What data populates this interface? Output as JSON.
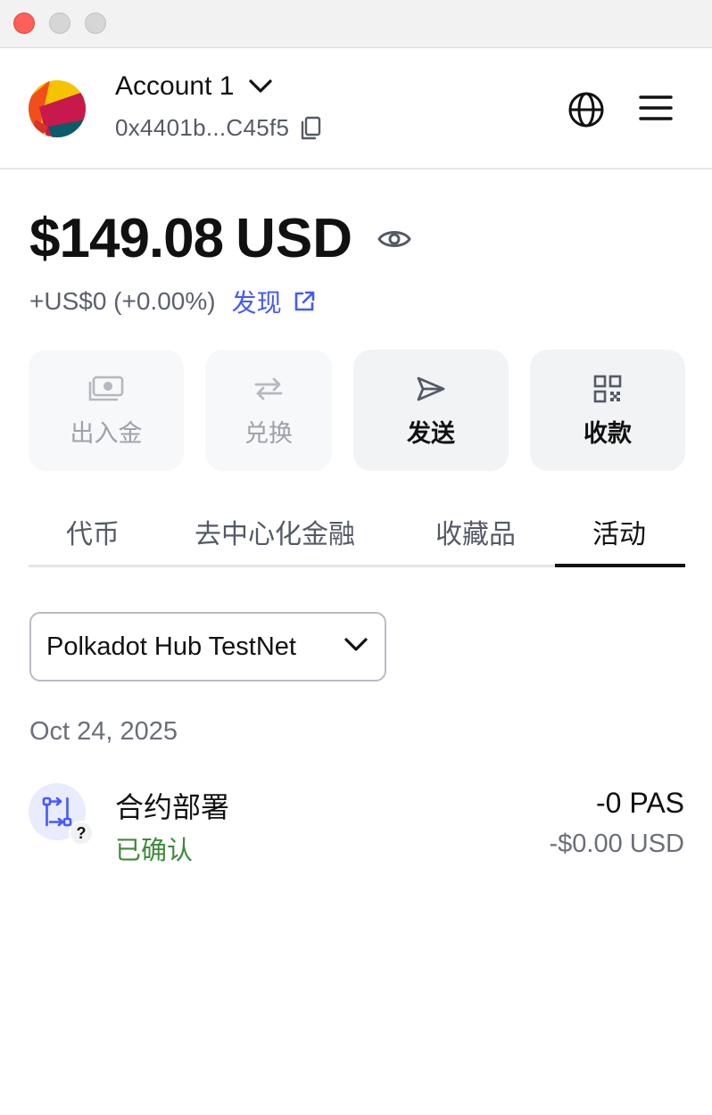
{
  "header": {
    "account_name": "Account 1",
    "account_address": "0x4401b...C45f5"
  },
  "balance": {
    "amount": "$149.08",
    "currency": "USD",
    "change": "+US$0 (+0.00%)",
    "discover_label": "发现"
  },
  "actions": [
    {
      "label": "出入金",
      "icon": "buy-sell-icon",
      "enabled": false
    },
    {
      "label": "兑换",
      "icon": "swap-icon",
      "enabled": false
    },
    {
      "label": "发送",
      "icon": "send-icon",
      "enabled": true
    },
    {
      "label": "收款",
      "icon": "qr-code-icon",
      "enabled": true
    }
  ],
  "tabs": [
    {
      "label": "代币",
      "active": false
    },
    {
      "label": "去中心化金融",
      "active": false
    },
    {
      "label": "收藏品",
      "active": false
    },
    {
      "label": "活动",
      "active": true
    }
  ],
  "network_filter": {
    "selected": "Polkadot Hub TestNet"
  },
  "activity": {
    "groups": [
      {
        "date": "Oct 24, 2025",
        "items": [
          {
            "title": "合约部署",
            "status": "已确认",
            "amount": "-0 PAS",
            "fiat": "-$0.00 USD",
            "badge": "?"
          }
        ]
      }
    ]
  },
  "colors": {
    "accent_link": "#4459ff",
    "status_confirmed": "#3f8a3a",
    "close_button": "#ff5f57"
  }
}
